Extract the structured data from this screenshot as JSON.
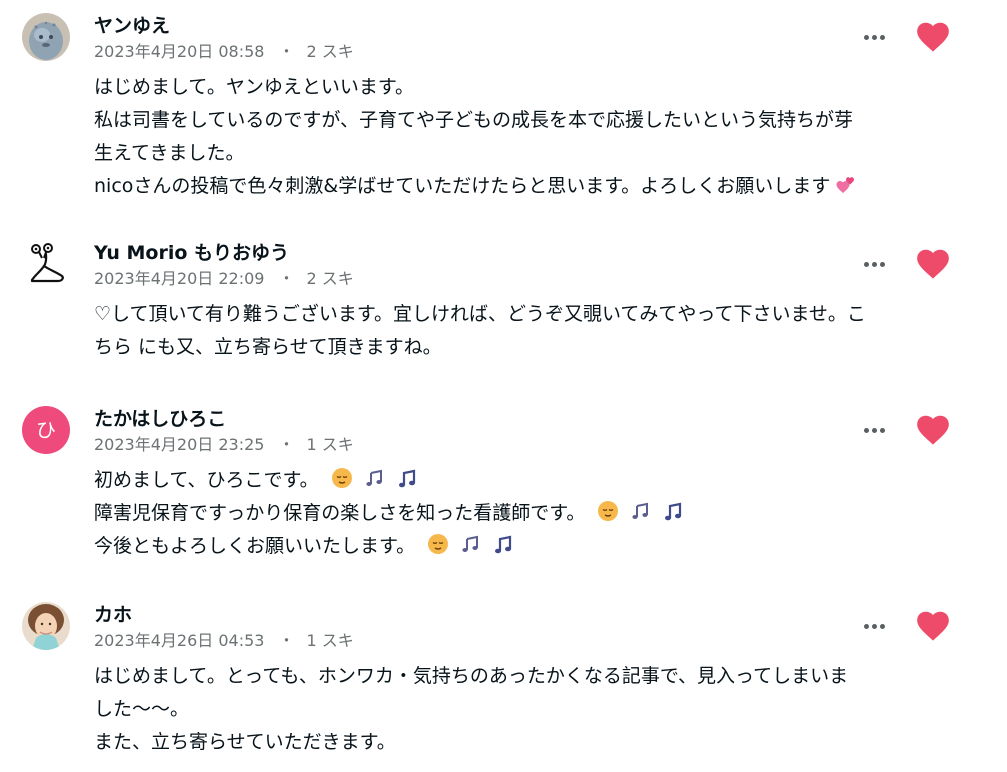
{
  "comments": [
    {
      "name": "ヤンゆえ",
      "date": "2023年4月20日 08:58",
      "likes": "2 スキ",
      "lines": [
        "はじめまして。ヤンゆえといいます。",
        "私は司書をしているのですが、子育てや子どもの成長を本で応援したいという気持ちが芽",
        "生えてきました。",
        "nicoさんの投稿で色々刺激&学ばせていただけたらと思います。よろしくお願いします"
      ],
      "avatar_icon": "stone-figure-avatar",
      "trailing_emoji": "two-hearts-icon"
    },
    {
      "name": "Yu Morio もりおゆう",
      "date": "2023年4月20日 22:09",
      "likes": "2 スキ",
      "lines": [
        "♡して頂いて有り難うございます。宜しければ、どうぞ又覗いてみてやって下さいませ。こ",
        "ちら にも又、立ち寄らせて頂きますね。"
      ],
      "avatar_icon": "snail-sketch-avatar"
    },
    {
      "name": "たかはしひろこ",
      "date": "2023年4月20日 23:25",
      "likes": "1 スキ",
      "avatar_initial": "ひ",
      "lines": [
        "初めまして、ひろこです。",
        "障害児保育ですっかり保育の楽しさを知った看護師です。",
        "今後ともよろしくお願いいたします。"
      ],
      "line_emojis": [
        "relieved-face-icon",
        "notes-icon",
        "music-note-icon"
      ]
    },
    {
      "name": "カホ",
      "date": "2023年4月26日 04:53",
      "likes": "1 スキ",
      "lines": [
        "はじめまして。とっても、ホンワカ・気持ちのあったかくなる記事で、見入ってしまいま",
        "した〜〜。",
        "また、立ち寄らせていただきます。"
      ],
      "avatar_icon": "woman-photo-avatar"
    }
  ],
  "meta_separator": "・",
  "colors": {
    "like_heart": "#ee4a6a",
    "avatar_initial_bg": "#ee4a7c",
    "meta_text": "#6c7274",
    "body_text": "#08131a"
  }
}
